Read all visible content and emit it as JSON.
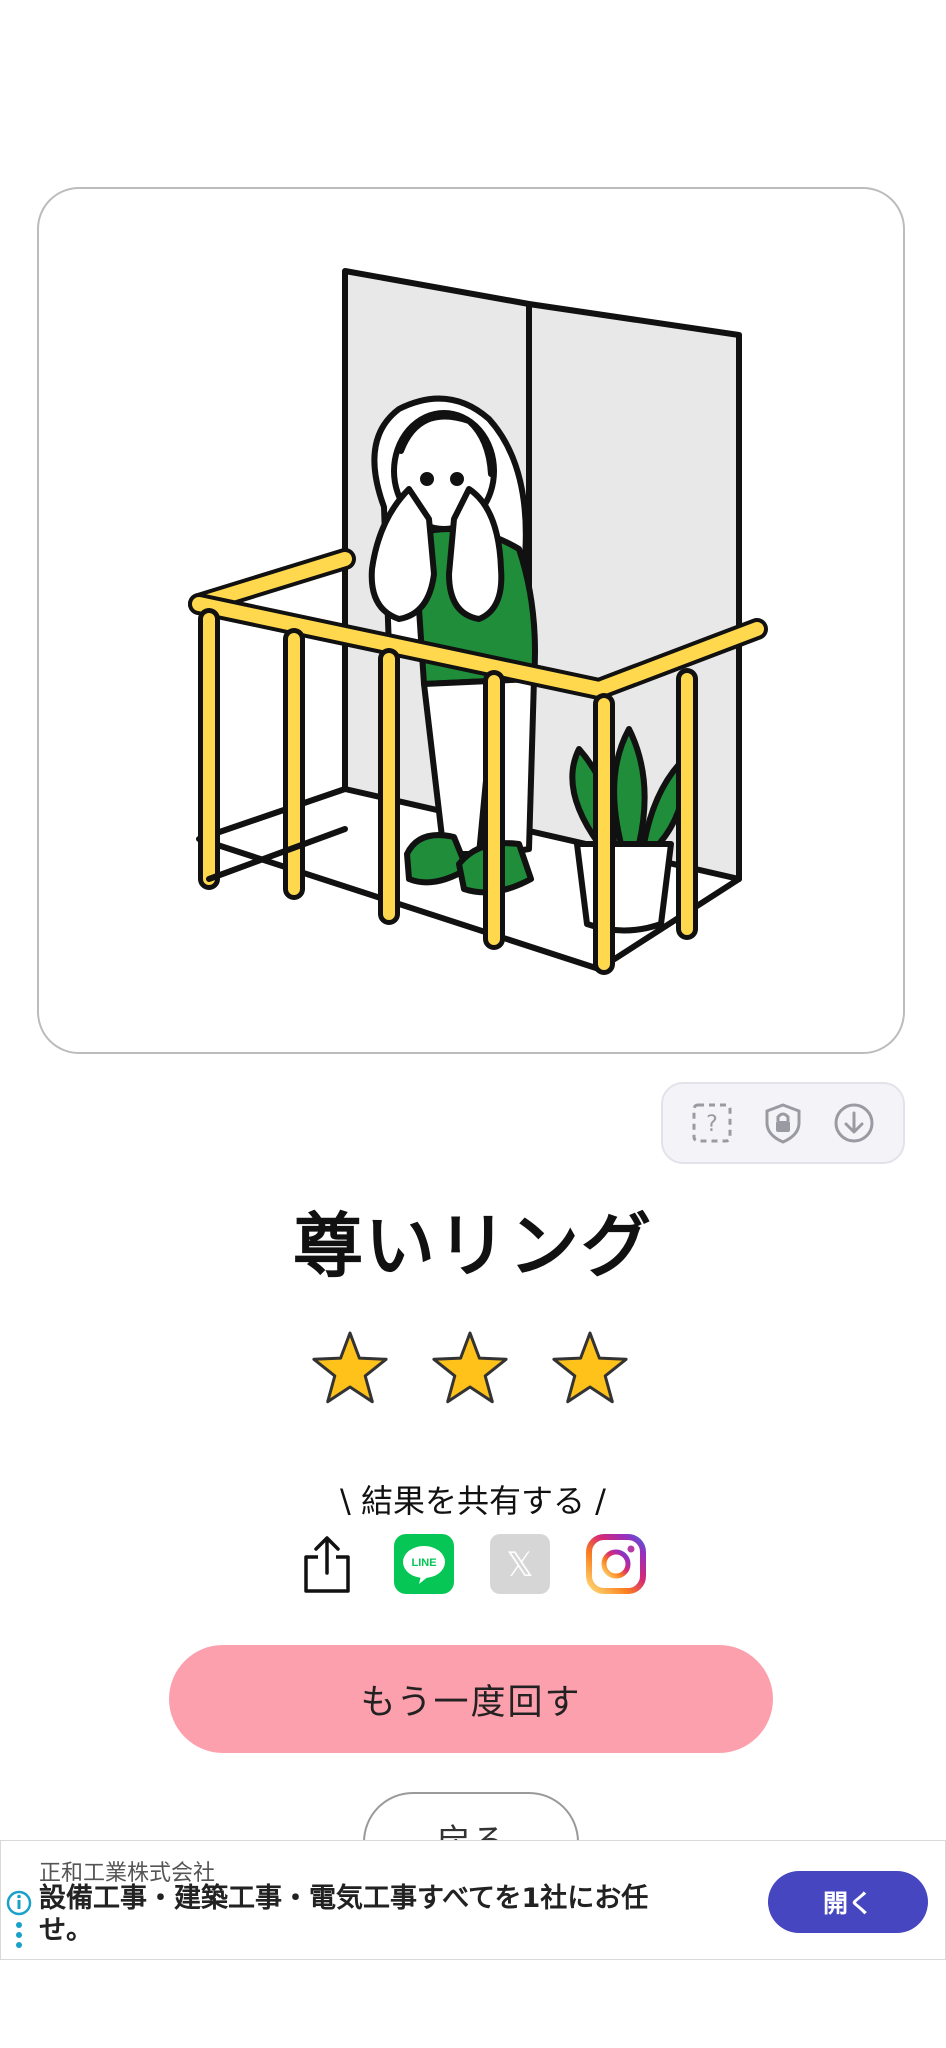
{
  "result": {
    "title": "尊いリング",
    "stars": 3,
    "max_stars": 3
  },
  "share": {
    "caption": "\\ 結果を共有する /",
    "line_label": "LINE",
    "x_label": "𝕏"
  },
  "actions": {
    "spin_again_label": "もう一度回す",
    "back_label": "戻る"
  },
  "ad": {
    "sponsor": "正和工業株式会社",
    "text": "設備工事・建築工事・電気工事すべてを1社にお任せ。",
    "open_label": "開く"
  },
  "colors": {
    "railing": "#ffd84d",
    "green": "#1f8d3a",
    "star": "#ffc21a",
    "primary_button": "#fda0ad",
    "ad_button": "#4546c0",
    "line_brand": "#06c755"
  }
}
